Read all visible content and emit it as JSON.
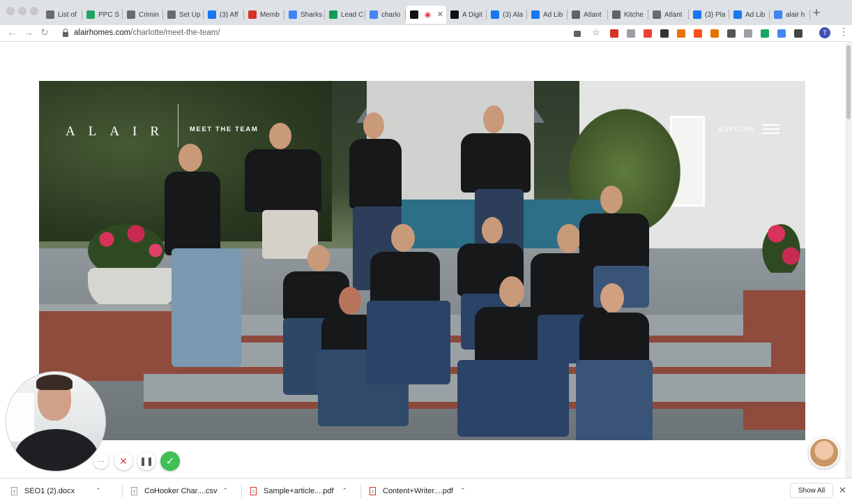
{
  "browser": {
    "tabs": [
      {
        "label": "List of",
        "icon": "hat-icon",
        "color": "#6b6b6b"
      },
      {
        "label": "PPC S",
        "icon": "drive-icon",
        "color": "#1fa463"
      },
      {
        "label": "Crimin",
        "icon": "hat-icon",
        "color": "#6b6b6b"
      },
      {
        "label": "Set Up",
        "icon": "hat-icon",
        "color": "#6b6b6b"
      },
      {
        "label": "(3) Aff",
        "icon": "facebook-icon",
        "color": "#1877f2"
      },
      {
        "label": "Memb",
        "icon": "gmail-icon",
        "color": "#d93025"
      },
      {
        "label": "Sharks",
        "icon": "docs-icon",
        "color": "#4285f4"
      },
      {
        "label": "Lead C",
        "icon": "sheets-icon",
        "color": "#0f9d58"
      },
      {
        "label": "charlo",
        "icon": "google-icon",
        "color": "#4285f4"
      },
      {
        "label": "",
        "icon": "alair-icon",
        "color": "#111111",
        "active": true
      },
      {
        "label": "A Digit",
        "icon": "bo-icon",
        "color": "#111111"
      },
      {
        "label": "(3) Ala",
        "icon": "facebook-icon",
        "color": "#1877f2"
      },
      {
        "label": "Ad Lib",
        "icon": "facebook-icon",
        "color": "#1877f2"
      },
      {
        "label": "Atlant",
        "icon": "globe-icon",
        "color": "#5f6368"
      },
      {
        "label": "Kitche",
        "icon": "globe-icon",
        "color": "#5f6368"
      },
      {
        "label": "Atlant",
        "icon": "hat-icon",
        "color": "#6b6b6b"
      },
      {
        "label": "(3) Pla",
        "icon": "facebook-icon",
        "color": "#1877f2"
      },
      {
        "label": "Ad Lib",
        "icon": "facebook-icon",
        "color": "#1877f2"
      },
      {
        "label": "alair h",
        "icon": "google-icon",
        "color": "#4285f4"
      }
    ],
    "url_domain": "alairhomes.com",
    "url_path": "/charlotte/meet-the-team/",
    "profile_initial": "T",
    "extension_colors": [
      "#d93025",
      "#9aa0a6",
      "#ea4335",
      "#333333",
      "#e8710a",
      "#f4511e",
      "#e37400",
      "#555555",
      "#9aa0a6",
      "#16a765",
      "#4285f4",
      "#444444"
    ]
  },
  "hero": {
    "logo": "ALAIR",
    "section_label": "MEET THE TEAM",
    "nav_label": "EXPLORE"
  },
  "recorder": {
    "more": "···",
    "cancel": "✕",
    "pause": "❚❚",
    "done": "✓"
  },
  "downloads": {
    "items": [
      {
        "name": "SEO1 (2).docx",
        "type": "doc"
      },
      {
        "name": "CoHooker Char....csv",
        "type": "csv"
      },
      {
        "name": "Sample+article....pdf",
        "type": "pdf"
      },
      {
        "name": "Content+Writer....pdf",
        "type": "pdf"
      }
    ],
    "show_all": "Show All"
  }
}
